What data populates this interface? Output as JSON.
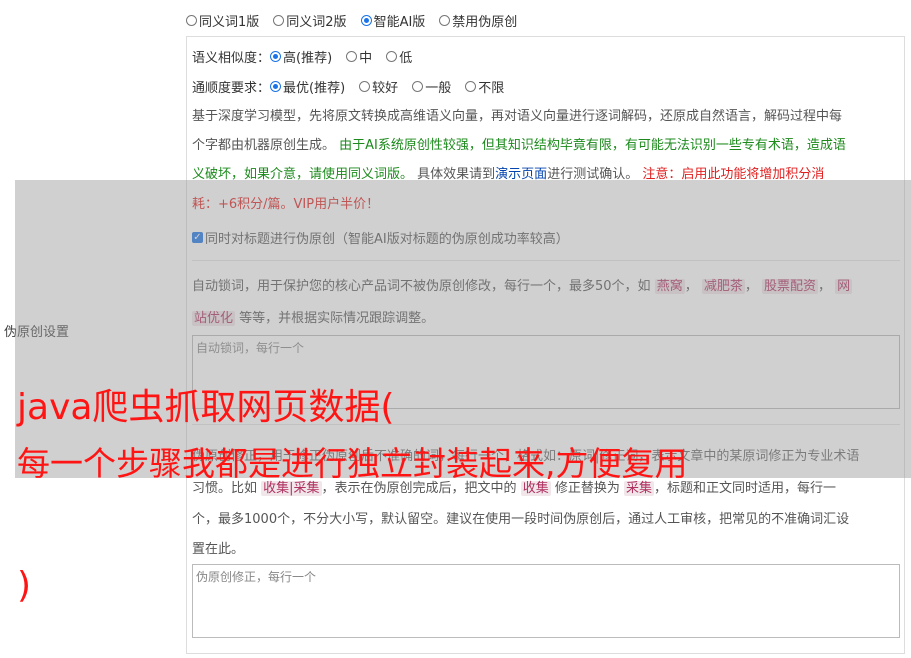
{
  "version_options": [
    {
      "label": "同义词1版",
      "selected": false
    },
    {
      "label": "同义词2版",
      "selected": false
    },
    {
      "label": "智能AI版",
      "selected": true
    },
    {
      "label": "禁用伪原创",
      "selected": false
    }
  ],
  "side_label": "伪原创设置",
  "similarity": {
    "label": "语义相似度：",
    "options": [
      {
        "label": "高(推荐)",
        "selected": true
      },
      {
        "label": "中",
        "selected": false
      },
      {
        "label": "低",
        "selected": false
      }
    ]
  },
  "fluency": {
    "label": "通顺度要求：",
    "options": [
      {
        "label": "最优(推荐)",
        "selected": true
      },
      {
        "label": "较好",
        "selected": false
      },
      {
        "label": "一般",
        "selected": false
      },
      {
        "label": "不限",
        "selected": false
      }
    ]
  },
  "desc": {
    "line1": "基于深度学习模型，先将原文转换成高维语义向量，再对语义向量进行逐词解码，还原成自然语言，解码过程中每",
    "line2a": "个字都由机器原创生成。",
    "line2b": "由于AI系统原创性较强，但其知识结构毕竟有限，有可能无法识别一些专有术语，造成语",
    "line3a": "义破坏，如果介意，请使用同义词版。",
    "line3b": "具体效果请到",
    "line3c": "演示页面",
    "line3d": "进行测试确认。",
    "line3e": "注意：启用此功能将增加积分消",
    "line4": "耗：+6积分/篇。VIP用户半价！"
  },
  "title_checkbox_label": "同时对标题进行伪原创（智能AI版对标题的伪原创成功率较高）",
  "lock": {
    "line1a": "自动锁词，用于保护您的核心产品词不被伪原创修改，每行一个，最多50个，如",
    "kw1": "燕窝",
    "kw2": "减肥茶",
    "kw3": "股票配资",
    "kw4a": "网",
    "kw4b": "站优化",
    "line2b": "等等，并根据实际情况跟踪调整。",
    "placeholder": "自动锁词，每行一个"
  },
  "fix": {
    "line1": "伪原创修正，用于修正伪原创后不准确的词，每行一个，格式如：原词|修正词，表示文章中的某原词修正为专业术语",
    "line2a": "习惯。比如",
    "kw1": "收集|采集",
    "line2b": "，表示在伪原创完成后，把文中的",
    "kw2": "收集",
    "line2c": "修正替换为",
    "kw3": "采集",
    "line2d": "，标题和正文同时适用，每行一",
    "line3": "个，最多1000个，不分大小写，默认留空。建议在使用一段时间伪原创后，通过人工审核，把常见的不准确词汇设",
    "line4": "置在此。",
    "placeholder": "伪原创修正，每行一个"
  },
  "watermark": {
    "line1": "java爬虫抓取网页数据(",
    "line2": "每一个步骤我都是进行独立封装起来,方便复用",
    "line3": ")"
  }
}
